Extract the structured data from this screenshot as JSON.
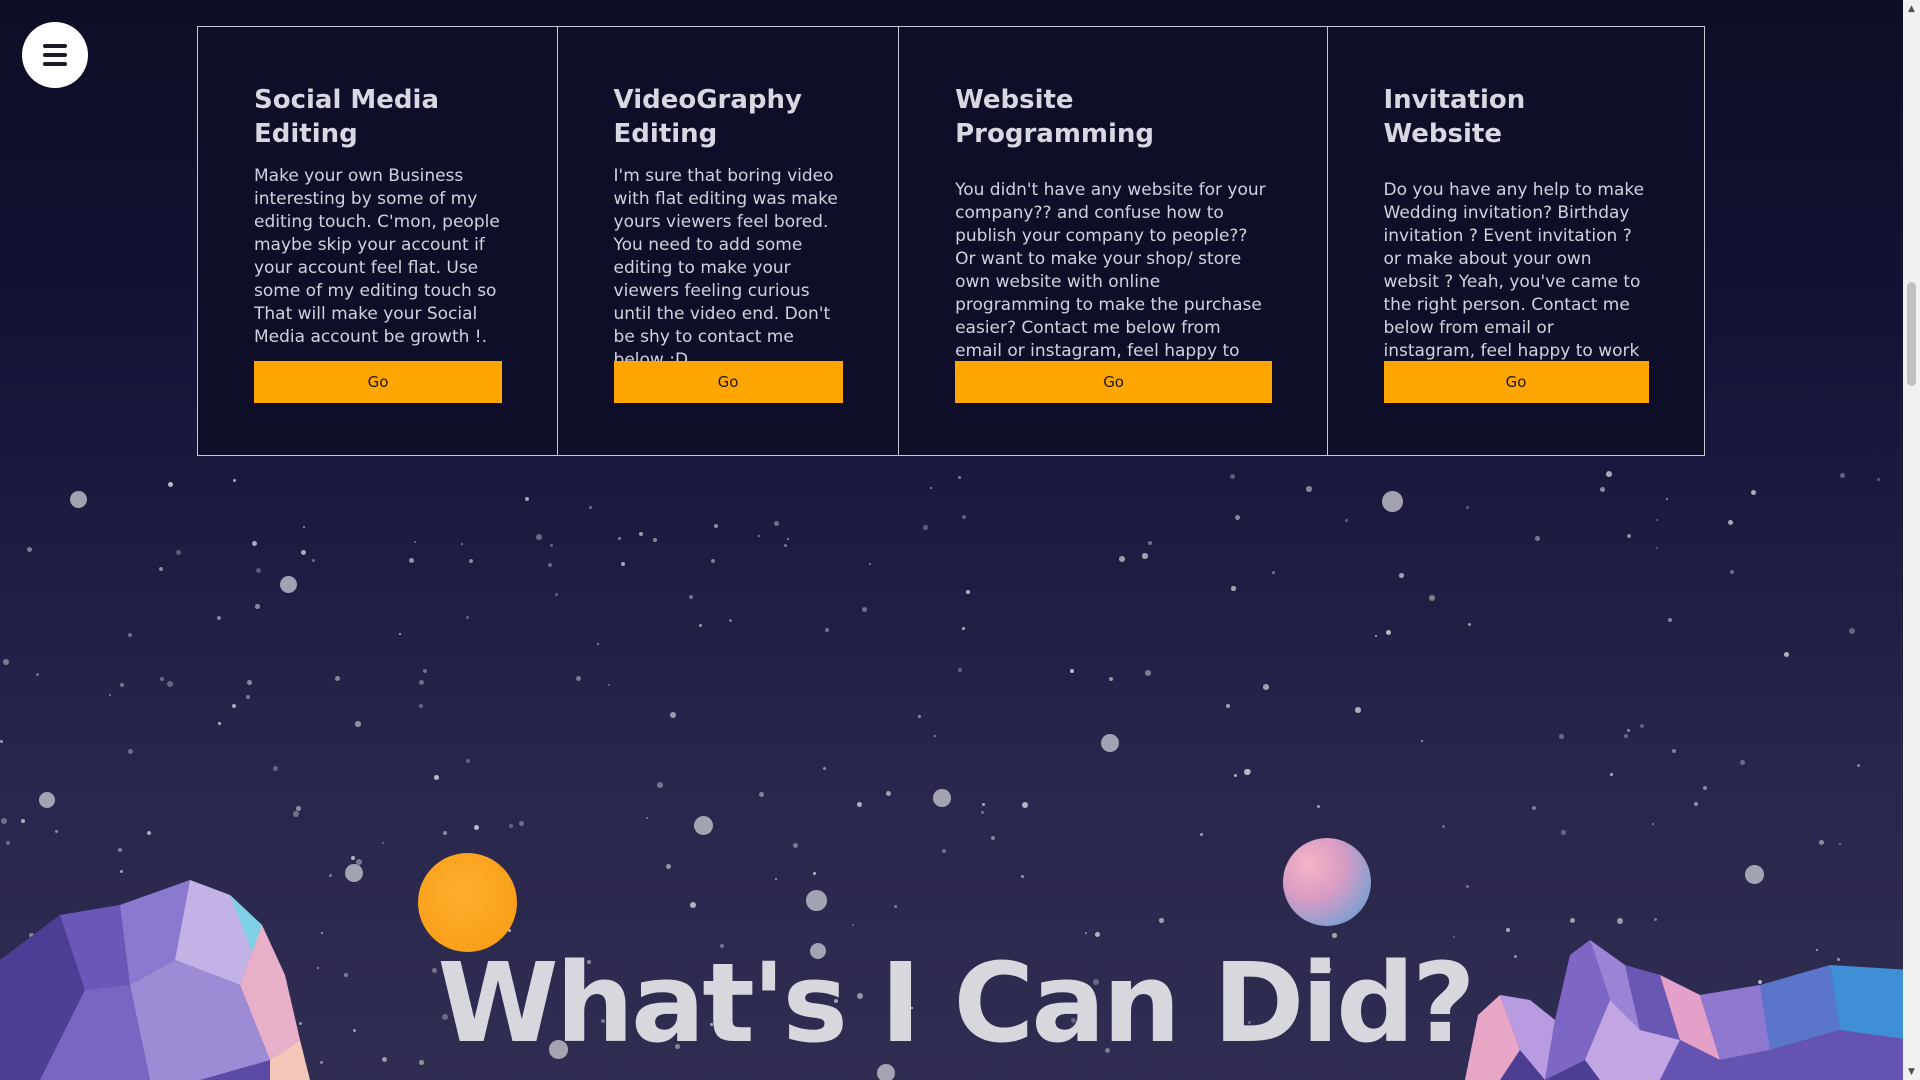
{
  "menu": {
    "icon": "hamburger-menu-icon"
  },
  "services": [
    {
      "title": "Social Media Editing",
      "description": "Make your own Business interesting by some of my editing touch. C'mon, people maybe skip your account if your account feel flat. Use some of my editing touch so That will make your Social Media account be growth !.",
      "button_label": "Go"
    },
    {
      "title": "VideoGraphy Editing",
      "description": "I'm sure that boring video with flat editing was make yours viewers feel bored. You need to add some editing to make your viewers feeling curious until the video end. Don't be shy to contact me below :D",
      "button_label": "Go"
    },
    {
      "title": "Website Programming",
      "description": "You didn't have any website for your company?? and confuse how to publish your company to people?? Or want to make your shop/ store own website with online programming to make the purchase easier? Contact me below from email or instagram, feel happy to work with you.",
      "button_label": "Go"
    },
    {
      "title": "Invitation Website",
      "description": "Do you have any help to make Wedding invitation? Birthday invitation ? Event invitation ? or make about your own websit ? Yeah, you've came to the right person. Contact me below from email or instagram, feel happy to work with you.",
      "button_label": "Go"
    }
  ],
  "section": {
    "title": "What's I Can Did?"
  },
  "colors": {
    "accent_button": "#ffa500",
    "background_top": "#0d0d26",
    "background_bottom": "#302d52",
    "planet_orange": "#f79a12",
    "planet_pink": "#d89cc4",
    "text": "#d8d8e2"
  }
}
